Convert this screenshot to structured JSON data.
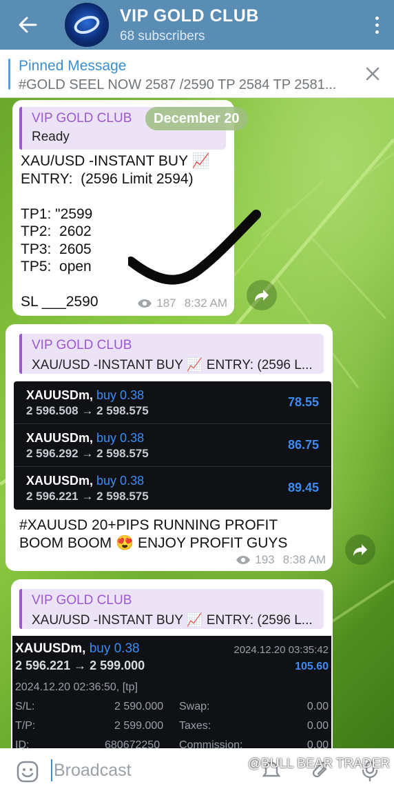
{
  "header": {
    "title": "VIP GOLD CLUB",
    "subtitle": "68 subscribers"
  },
  "pinned": {
    "title": "Pinned Message",
    "text": "#GOLD SEEL NOW 2587 /2590 TP 2584 TP 2581..."
  },
  "date_pill": "December 20",
  "messages": [
    {
      "quote_name": "VIP GOLD CLUB",
      "quote_text": "Ready",
      "body": "XAU/USD -INSTANT BUY 📈\nENTRY:  (2596 Limit 2594)\n\nTP1: \"2599\nTP2:  2602\nTP3:  2605\nTP5:  open\n\nSL ___2590",
      "views": "187",
      "time": "8:32 AM"
    },
    {
      "quote_name": "VIP GOLD CLUB",
      "quote_text": "XAU/USD -INSTANT BUY 📈     ENTRY:  (2596 L...",
      "trades": [
        {
          "symbol": "XAUUSDm,",
          "side": "buy 0.38",
          "prices": "2 596.508 → 2 598.575",
          "profit": "78.55"
        },
        {
          "symbol": "XAUUSDm,",
          "side": "buy 0.38",
          "prices": "2 596.292 → 2 598.575",
          "profit": "86.75"
        },
        {
          "symbol": "XAUUSDm,",
          "side": "buy 0.38",
          "prices": "2 596.221 → 2 598.575",
          "profit": "89.45"
        }
      ],
      "body": "#XAUUSD 20+PIPS RUNNING PROFIT\nBOOM BOOM 😍 ENJOY PROFIT GUYS",
      "views": "193",
      "time": "8:38 AM"
    },
    {
      "quote_name": "VIP GOLD CLUB",
      "quote_text": "XAU/USD -INSTANT BUY 📈     ENTRY:  (2596 L...",
      "detail": {
        "symbol": "XAUUSDm,",
        "side": "buy 0.38",
        "close_time": "2024.12.20 03:35:42",
        "prices": "2 596.221 → 2 599.000",
        "profit": "105.60",
        "open_time": "2024.12.20 02:36:50, [tp]",
        "sl_label": "S/L:",
        "sl_value": "2 590.000",
        "swap_label": "Swap:",
        "swap_value": "0.00",
        "tp_label": "T/P:",
        "tp_value": "2 599.000",
        "taxes_label": "Taxes:",
        "taxes_value": "0.00",
        "id_label": "ID:",
        "id_value": "680672250",
        "commission_label": "Commission:",
        "commission_value": "0.00"
      }
    }
  ],
  "input": {
    "placeholder": "Broadcast"
  },
  "watermark": "@BULL BEAR TRADER"
}
